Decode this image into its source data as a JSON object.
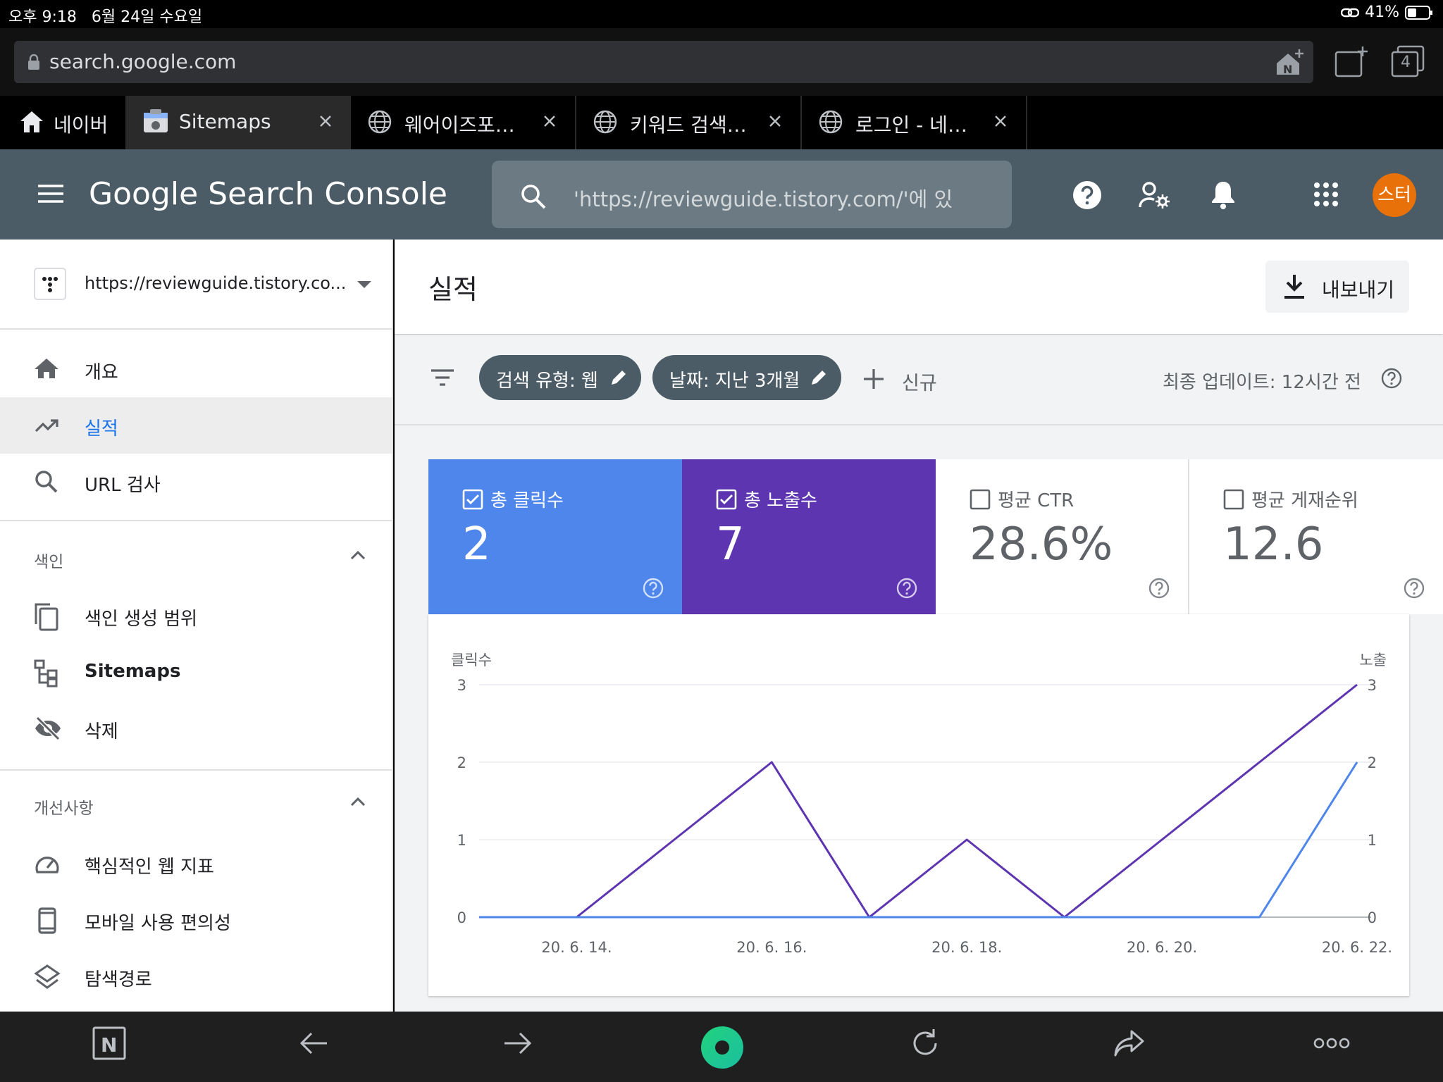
{
  "status_bar": {
    "time": "오후 9:18",
    "date": "6월 24일 수요일",
    "battery": "41%"
  },
  "address_bar": {
    "url": "search.google.com",
    "tab_count": "4"
  },
  "tabs": [
    {
      "label": "네이버"
    },
    {
      "label": "Sitemaps"
    },
    {
      "label": "웨어이즈포…"
    },
    {
      "label": "키워드 검색…"
    },
    {
      "label": "로그인 - 네…"
    }
  ],
  "header": {
    "product_google": "Google",
    "product_name": "Search Console",
    "search_placeholder": "'https://reviewguide.tistory.com/'에 있",
    "avatar_text": "스터"
  },
  "sidebar": {
    "property": "https://reviewguide.tistory.co...",
    "main_items": [
      {
        "label": "개요"
      },
      {
        "label": "실적"
      },
      {
        "label": "URL 검사"
      }
    ],
    "index_section": {
      "title": "색인",
      "items": [
        {
          "label": "색인 생성 범위"
        },
        {
          "label": "Sitemaps"
        },
        {
          "label": "삭제"
        }
      ]
    },
    "improve_section": {
      "title": "개선사항",
      "items": [
        {
          "label": "핵심적인 웹 지표"
        },
        {
          "label": "모바일 사용 편의성"
        },
        {
          "label": "탐색경로"
        }
      ]
    }
  },
  "main": {
    "title": "실적",
    "export_label": "내보내기",
    "filters": [
      {
        "label": "검색 유형: 웹"
      },
      {
        "label": "날짜: 지난 3개월"
      }
    ],
    "new_label": "신규",
    "last_update": "최종 업데이트: 12시간 전",
    "metrics": [
      {
        "label": "총 클릭수",
        "value": "2",
        "checked": true,
        "color": "#4f86ec"
      },
      {
        "label": "총 노출수",
        "value": "7",
        "checked": true,
        "color": "#5e35b1"
      },
      {
        "label": "평균 CTR",
        "value": "28.6%",
        "checked": false,
        "color": "#ffffff"
      },
      {
        "label": "평균 게재순위",
        "value": "12.6",
        "checked": false,
        "color": "#ffffff"
      }
    ]
  },
  "chart_data": {
    "type": "line",
    "x": [
      "20. 6. 13.",
      "20. 6. 14.",
      "20. 6. 15.",
      "20. 6. 16.",
      "20. 6. 17.",
      "20. 6. 18.",
      "20. 6. 19.",
      "20. 6. 20.",
      "20. 6. 21.",
      "20. 6. 22."
    ],
    "x_tick_labels": [
      "20. 6. 14.",
      "20. 6. 16.",
      "20. 6. 18.",
      "20. 6. 20.",
      "20. 6. 22."
    ],
    "series": [
      {
        "name": "클릭수",
        "axis": "left",
        "color": "#4f86ec",
        "values": [
          0,
          0,
          0,
          0,
          0,
          0,
          0,
          0,
          0,
          2
        ]
      },
      {
        "name": "노출",
        "axis": "right",
        "color": "#5e35b1",
        "values": [
          0,
          0,
          1,
          2,
          0,
          1,
          0,
          1,
          2,
          3
        ]
      }
    ],
    "ylabel_left": "클릭수",
    "ylabel_right": "노출",
    "ylim_left": [
      0,
      3
    ],
    "ylim_right": [
      0,
      3
    ],
    "y_ticks": [
      "0",
      "1",
      "2",
      "3"
    ],
    "grid": true
  }
}
